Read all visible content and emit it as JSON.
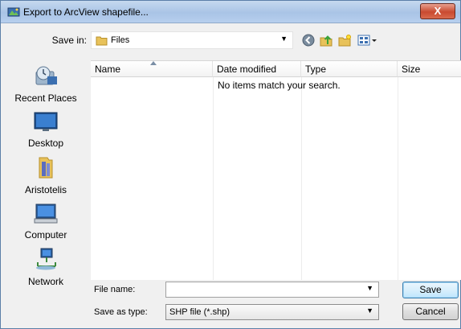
{
  "window": {
    "title": "Export to ArcView shapefile...",
    "close_label": "X"
  },
  "toolbar": {
    "save_in_label": "Save in:",
    "save_in_value": "Files",
    "icons": [
      "back-icon",
      "up-folder-icon",
      "new-folder-icon",
      "views-icon"
    ]
  },
  "places": [
    {
      "label": "Recent Places",
      "icon": "recent-places-icon"
    },
    {
      "label": "Desktop",
      "icon": "desktop-icon"
    },
    {
      "label": "Aristotelis",
      "icon": "user-folder-icon"
    },
    {
      "label": "Computer",
      "icon": "computer-icon"
    },
    {
      "label": "Network",
      "icon": "network-icon"
    }
  ],
  "file_list": {
    "columns": [
      "Name",
      "Date modified",
      "Type",
      "Size"
    ],
    "empty_message": "No items match your search."
  },
  "bottom": {
    "file_name_label": "File name:",
    "file_name_value": "",
    "save_as_type_label": "Save as type:",
    "save_as_type_value": "SHP file (*.shp)",
    "save_button": "Save",
    "cancel_button": "Cancel"
  },
  "colors": {
    "title_bar": "#b7cfee",
    "close_button": "#c94a30",
    "default_button": "#3c7fb1"
  }
}
